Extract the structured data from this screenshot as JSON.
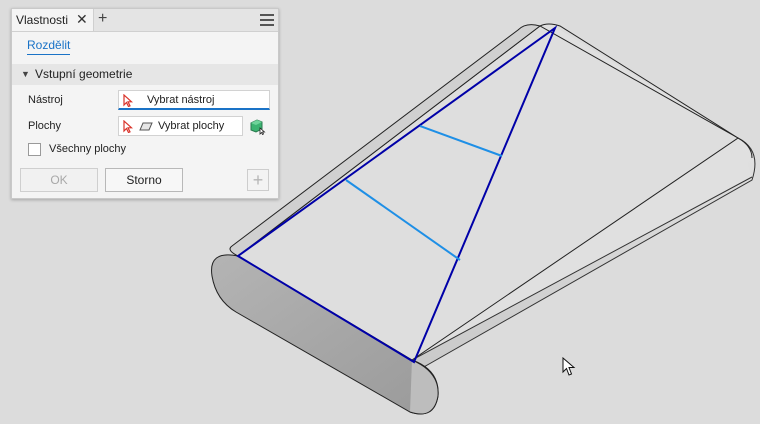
{
  "panel": {
    "title": "Vlastnosti",
    "split_tab": "Rozdělit",
    "section": "Vstupní geometrie",
    "tool_label": "Nástroj",
    "tool_placeholder": "Vybrat nástroj",
    "faces_label": "Plochy",
    "faces_placeholder": "Vybrat plochy",
    "all_faces_label": "Všechny plochy",
    "all_faces_checked": false,
    "ok_label": "OK",
    "cancel_label": "Storno"
  },
  "icons": {
    "close": "close-icon",
    "add": "plus-icon",
    "menu": "hamburger-menu-icon",
    "select": "select-cursor-icon",
    "face": "face-icon",
    "solid": "solid-body-icon",
    "pointer": "mouse-pointer-icon"
  },
  "colors": {
    "accent": "#1a73c7",
    "split_line": "#0000a8",
    "split_preview": "#1e8fe6",
    "viewport_bg": "#dcdcdc"
  }
}
